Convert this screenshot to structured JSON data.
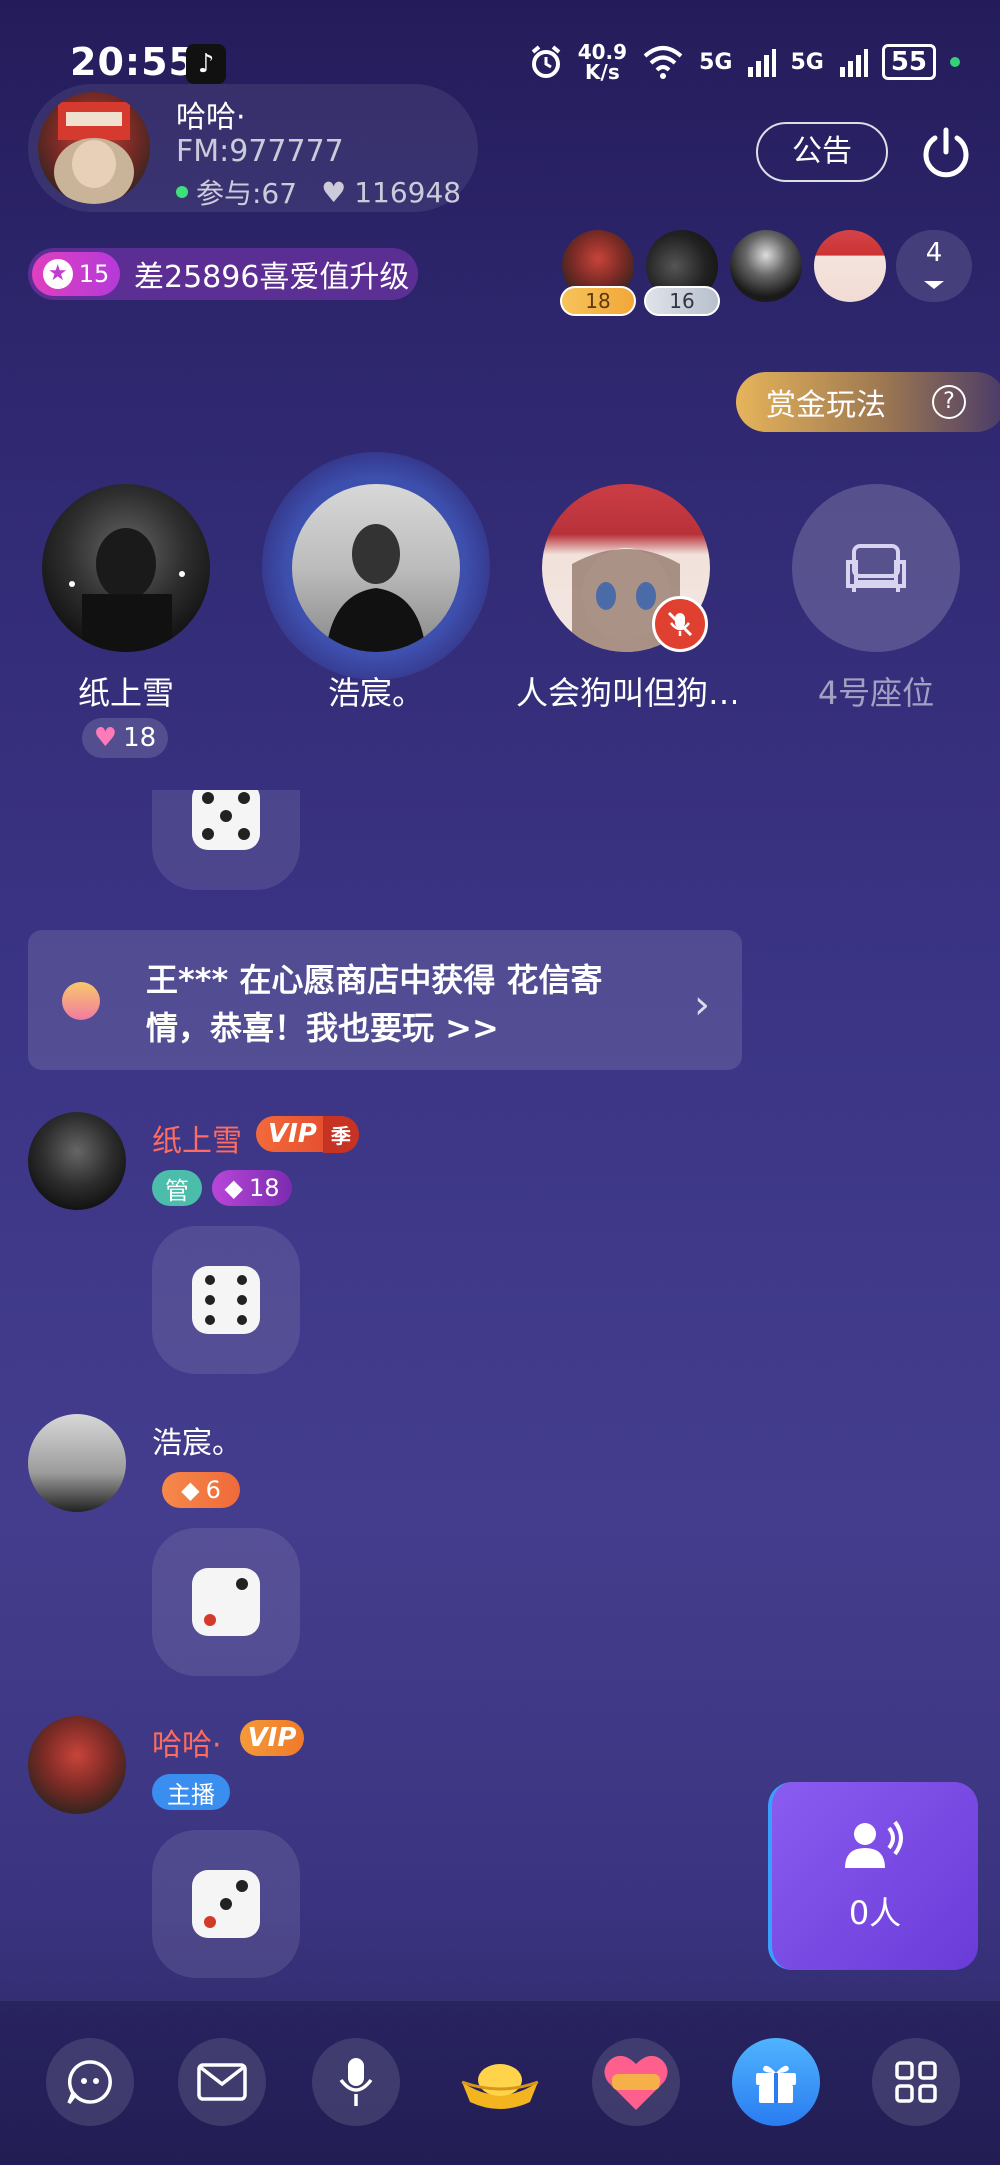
{
  "status_bar": {
    "time": "20:55",
    "net_speed": "40.9\nK/s",
    "sim1": "5G",
    "sim2": "5G",
    "battery": "55"
  },
  "room": {
    "name": "哈哈·",
    "fm": "FM:977777",
    "participants": "参与:67",
    "likes": "116948",
    "notice_label": "公告"
  },
  "level": {
    "number": "15",
    "text": "差25896喜爱值升级"
  },
  "ranking": {
    "tags": [
      "18",
      "16"
    ],
    "more_count": "4"
  },
  "bounty": {
    "label": "赏金玩法",
    "help": "?"
  },
  "seats": [
    {
      "name": "纸上雪",
      "hearts": "18"
    },
    {
      "name": "浩宸。"
    },
    {
      "name": "人会狗叫但狗…"
    },
    {
      "name": "4号座位"
    }
  ],
  "system_message": {
    "text": "王*** 在心愿商店中获得 花信寄情，恭喜！我也要玩 >>"
  },
  "messages": [
    {
      "name": "纸上雪",
      "vip": "VIP",
      "vip_season": "季",
      "tag_admin": "管",
      "level": "18"
    },
    {
      "name": "浩宸。",
      "level": "6"
    },
    {
      "name": "哈哈·",
      "vip": "VIP",
      "tag_host": "主播"
    }
  ],
  "call": {
    "count": "0人"
  },
  "colors": {
    "accent_pink": "#e13fc0",
    "name_red": "#ff6b5e",
    "vip_orange": "#f08a3a",
    "gift_blue": "#2a7cf0"
  }
}
